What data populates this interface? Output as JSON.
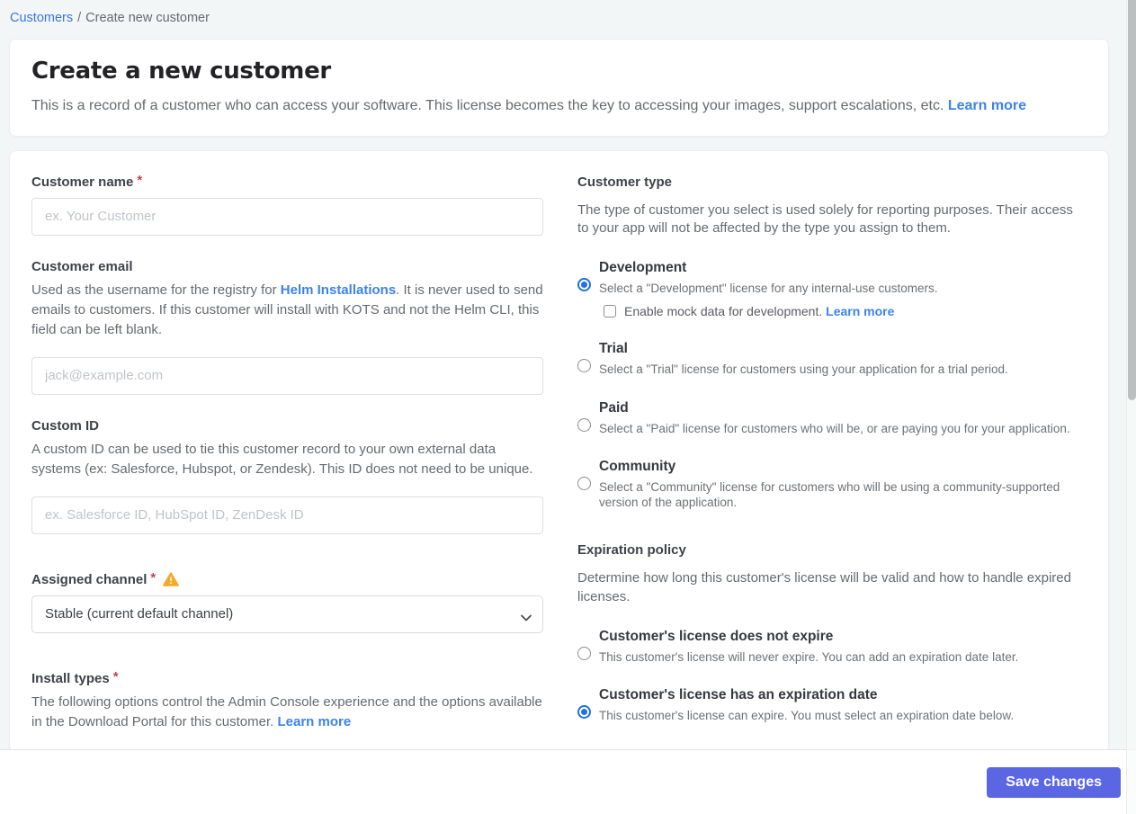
{
  "breadcrumb": {
    "link": "Customers",
    "separator": "/",
    "current": "Create new customer"
  },
  "header": {
    "title": "Create a new customer",
    "description": "This is a record of a customer who can access your software. This license becomes the key to accessing your images, support escalations, etc.",
    "learn_more": "Learn more"
  },
  "form": {
    "customer_name": {
      "label": "Customer name",
      "required_mark": "*",
      "placeholder": "ex. Your Customer",
      "value": ""
    },
    "customer_email": {
      "label": "Customer email",
      "desc_before": "Used as the username for the registry for ",
      "desc_link": "Helm Installations",
      "desc_after": ". It is never used to send emails to customers. If this customer will install with KOTS and not the Helm CLI, this field can be left blank.",
      "placeholder": "jack@example.com",
      "value": ""
    },
    "custom_id": {
      "label": "Custom ID",
      "description": "A custom ID can be used to tie this customer record to your own external data systems (ex: Salesforce, Hubspot, or Zendesk). This ID does not need to be unique.",
      "placeholder": "ex. Salesforce ID, HubSpot ID, ZenDesk ID",
      "value": ""
    },
    "assigned_channel": {
      "label": "Assigned channel",
      "required_mark": "*",
      "selected_option": "Stable (current default channel)"
    },
    "install_types": {
      "label": "Install types",
      "required_mark": "*",
      "description": "The following options control the Admin Console experience and the options available in the Download Portal for this customer.",
      "learn_more": "Learn more"
    },
    "customer_type": {
      "heading": "Customer type",
      "description": "The type of customer you select is used solely for reporting purposes. Their access to your app will not be affected by the type you assign to them.",
      "options": [
        {
          "name": "Development",
          "description": "Select a \"Development\" license for any internal-use customers.",
          "selected": true
        },
        {
          "name": "Trial",
          "description": "Select a \"Trial\" license for customers using your application for a trial period.",
          "selected": false
        },
        {
          "name": "Paid",
          "description": "Select a \"Paid\" license for customers who will be, or are paying you for your application.",
          "selected": false
        },
        {
          "name": "Community",
          "description": "Select a \"Community\" license for customers who will be using a community-supported version of the application.",
          "selected": false
        }
      ],
      "mock_data_checkbox": {
        "label": "Enable mock data for development.",
        "learn_more": "Learn more",
        "checked": false
      }
    },
    "expiration_policy": {
      "heading": "Expiration policy",
      "description": "Determine how long this customer's license will be valid and how to handle expired licenses.",
      "options": [
        {
          "name": "Customer's license does not expire",
          "description": "This customer's license will never expire. You can add an expiration date later.",
          "selected": false
        },
        {
          "name": "Customer's license has an expiration date",
          "description": "This customer's license can expire. You must select an expiration date below.",
          "selected": true
        }
      ]
    }
  },
  "footer": {
    "save_label": "Save changes"
  },
  "colors": {
    "accent_button": "#5b67e2",
    "link_blue": "#3c83ea",
    "radio_selected": "#2170e8",
    "warning_amber": "#f7a827",
    "required_red": "#c4454f",
    "page_background": "#f3f6f7"
  }
}
